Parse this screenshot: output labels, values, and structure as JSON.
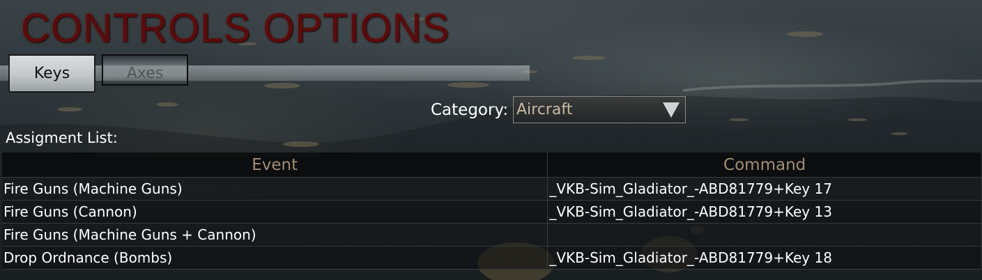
{
  "window": {
    "title": "CONTROLS OPTIONS"
  },
  "tabs": [
    {
      "label": "Keys",
      "active": true
    },
    {
      "label": "Axes",
      "active": false
    }
  ],
  "category": {
    "label": "Category:",
    "selected": "Aircraft"
  },
  "assignment_list": {
    "label": "Assigment List:",
    "columns": [
      "Event",
      "Command"
    ],
    "rows": [
      {
        "event": "Fire Guns (Machine Guns)",
        "command": "_VKB-Sim_Gladiator_-ABD81779+Key 17"
      },
      {
        "event": "Fire Guns (Cannon)",
        "command": "_VKB-Sim_Gladiator_-ABD81779+Key 13"
      },
      {
        "event": "Fire Guns (Machine Guns + Cannon)",
        "command": ""
      },
      {
        "event": "Drop Ordnance (Bombs)",
        "command": "_VKB-Sim_Gladiator_-ABD81779+Key 18"
      }
    ]
  },
  "colors": {
    "title": "#5a0c0c",
    "header_text": "#a38d74",
    "dropdown_text": "#c9b9a3",
    "row_text": "#ffffff"
  },
  "icons": {
    "dropdown": "chevron-down-icon"
  }
}
